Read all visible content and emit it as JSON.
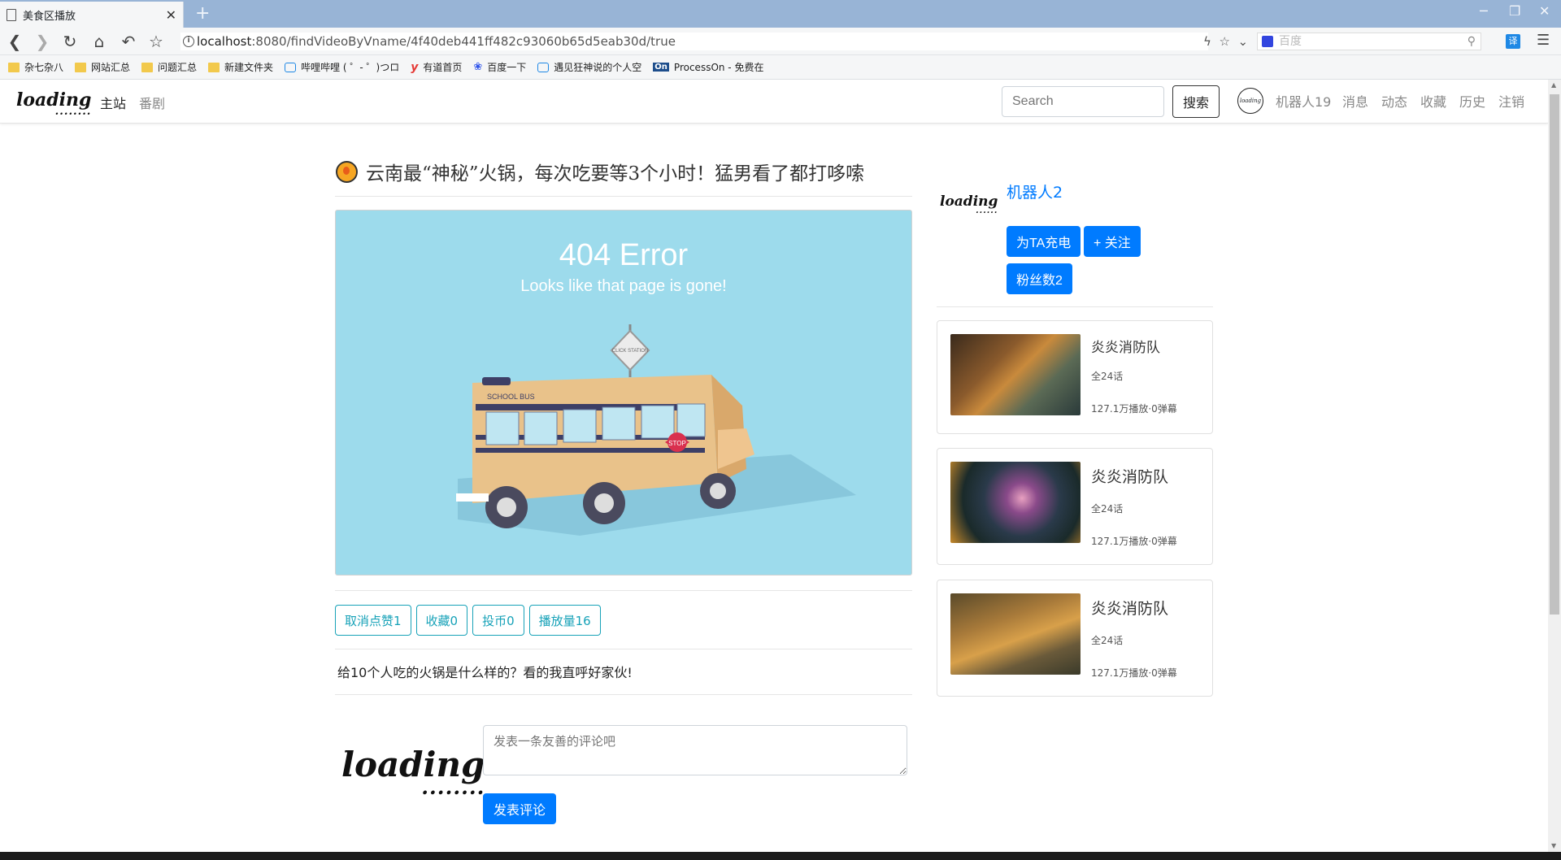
{
  "browser": {
    "tab_title": "美食区播放",
    "url_host": "localhost",
    "url_path": ":8080/findVideoByVname/4f40deb441ff482c93060b65d5eab30d/true",
    "search_placeholder": "百度",
    "translate_label": "译",
    "bookmarks": [
      {
        "icon": "folder-icon",
        "label": "杂七杂八"
      },
      {
        "icon": "folder-icon",
        "label": "网站汇总"
      },
      {
        "icon": "folder-icon",
        "label": "问题汇总"
      },
      {
        "icon": "folder-icon",
        "label": "新建文件夹"
      },
      {
        "icon": "bilibili-icon",
        "label": "哔哩哔哩 ( ゜- ゜)つロ"
      },
      {
        "icon": "youdao-icon",
        "label": "有道首页"
      },
      {
        "icon": "baidu-paw-icon",
        "label": "百度一下"
      },
      {
        "icon": "bilibili-icon",
        "label": "遇见狂神说的个人空"
      },
      {
        "icon": "processon-icon",
        "label": "ProcessOn - 免费在"
      }
    ]
  },
  "navbar": {
    "logo": "loading",
    "logo_dots": "........",
    "links": [
      "主站",
      "番剧"
    ],
    "search_placeholder": "Search",
    "search_button": "搜索",
    "avatar_text": "loading",
    "user": "机器人19",
    "right_links": [
      "消息",
      "动态",
      "收藏",
      "历史",
      "注销"
    ]
  },
  "video": {
    "title": "云南最“神秘”火锅，每次吃要等3个小时！猛男看了都打哆嗦",
    "error_title": "404 Error",
    "error_subtitle": "Looks like that page is gone!",
    "bus_label": "SCHOOL BUS",
    "stop_label": "STOP",
    "sign_label": "CLICK STATION",
    "stats": [
      "取消点赞1",
      "收藏0",
      "投币0",
      "播放量16"
    ],
    "description": "给10个人吃的火锅是什么样的？看的我直呼好家伙!"
  },
  "comment": {
    "logo": "loading",
    "logo_dots": "........",
    "placeholder": "发表一条友善的评论吧",
    "submit": "发表评论"
  },
  "uploader": {
    "logo": "loading",
    "logo_dots": "......",
    "name": "机器人2",
    "charge_button": "为TA充电",
    "follow_button": "+ 关注",
    "fans_button": "粉丝数2"
  },
  "recommendations": [
    {
      "title": "炎炎消防队",
      "episodes": "全24话",
      "meta": "127.1万播放·0弹幕"
    },
    {
      "title": "炎炎消防队",
      "episodes": "全24话",
      "meta": "127.1万播放·0弹幕"
    },
    {
      "title": "炎炎消防队",
      "episodes": "全24话",
      "meta": "127.1万播放·0弹幕"
    }
  ],
  "colors": {
    "primary": "#007bff",
    "info": "#17a2b8",
    "video_bg": "#9ddbec"
  }
}
